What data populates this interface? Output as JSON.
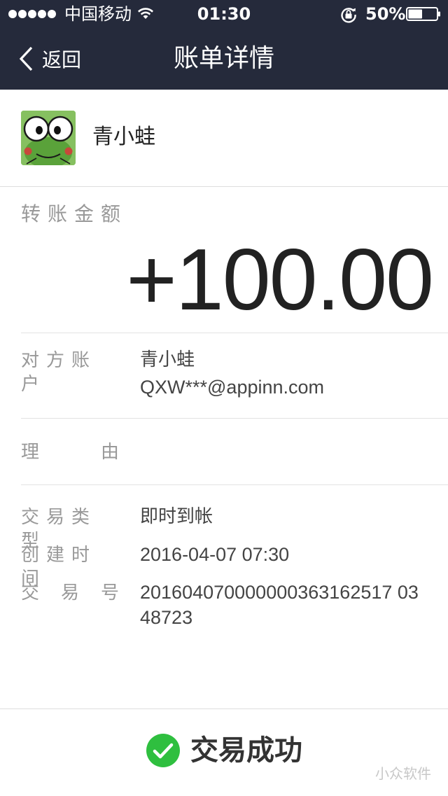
{
  "status_bar": {
    "carrier": "中国移动",
    "time": "01:30",
    "battery": "50%",
    "battery_level": 0.5
  },
  "nav": {
    "back_label": "返回",
    "title": "账单详情"
  },
  "payee": {
    "name": "青小蛙"
  },
  "amount": {
    "label": "转账金额",
    "value": "+100.00"
  },
  "counterparty": {
    "label": "对方账户",
    "name": "青小蛙",
    "account": "QXW***@appinn.com"
  },
  "reason": {
    "label_chars": [
      "理",
      "由"
    ]
  },
  "transaction": {
    "type_label": "交易类型",
    "type_value": "即时到帐",
    "created_label": "创建时间",
    "created_value": "2016-04-07 07:30",
    "number_label_chars": [
      "交",
      "易",
      "号"
    ],
    "number_value": "201604070000000363162517 0348723"
  },
  "footer": {
    "status": "交易成功",
    "watermark": "小众软件"
  },
  "colors": {
    "header_bg": "#252a3b",
    "success_green": "#2fbf3f",
    "label_gray": "#999999"
  }
}
